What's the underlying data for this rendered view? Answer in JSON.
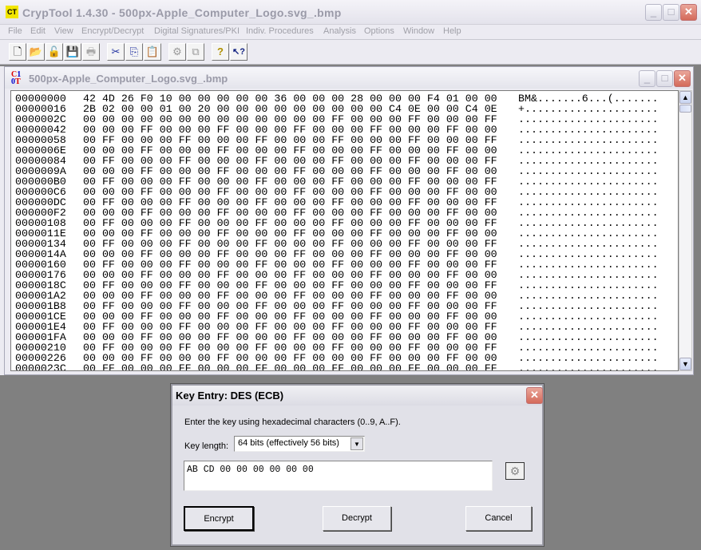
{
  "app": {
    "title": "CrypTool 1.4.30 - 500px-Apple_Computer_Logo.svg_.bmp",
    "icon": "cryptool-app-icon"
  },
  "window_controls": {
    "minimize": "_",
    "maximize": "□",
    "close": "✕"
  },
  "menu": [
    "File",
    "Edit",
    "View",
    "Encrypt/Decrypt",
    "Digital Signatures/PKI",
    "Indiv. Procedures",
    "Analysis",
    "Options",
    "Window",
    "Help"
  ],
  "toolbar": [
    {
      "name": "new-document-icon",
      "glyph": "🗋"
    },
    {
      "name": "open-folder-icon",
      "glyph": "📂"
    },
    {
      "name": "open-unlock-icon",
      "glyph": "🔓"
    },
    {
      "name": "save-disk-icon",
      "glyph": "💾"
    },
    {
      "name": "print-icon",
      "glyph": "🖶"
    },
    {
      "name": "cut-scissors-icon",
      "glyph": "✂"
    },
    {
      "name": "copy-icon",
      "glyph": "⎘"
    },
    {
      "name": "paste-icon",
      "glyph": "📋"
    },
    {
      "name": "key-icon",
      "glyph": "⚙"
    },
    {
      "name": "window-tile-icon",
      "glyph": "⧉"
    },
    {
      "name": "help-icon",
      "glyph": "?"
    },
    {
      "name": "context-help-icon",
      "glyph": "↖?"
    }
  ],
  "document": {
    "title": "500px-Apple_Computer_Logo.svg_.bmp",
    "icon": "ct-document-icon",
    "rows": [
      {
        "addr": "00000000",
        "hex": "42 4D 26 F0 10 00 00 00 00 00 36 00 00 00 28 00 00 00 F4 01 00 00",
        "ascii": "BM&.......6...(......."
      },
      {
        "addr": "00000016",
        "hex": "2B 02 00 00 01 00 20 00 00 00 00 00 00 00 00 00 C4 0E 00 00 C4 0E",
        "ascii": "+....................."
      },
      {
        "addr": "0000002C",
        "hex": "00 00 00 00 00 00 00 00 00 00 00 00 00 FF 00 00 00 FF 00 00 00 FF",
        "ascii": "......................"
      },
      {
        "addr": "00000042",
        "hex": "00 00 00 FF 00 00 00 FF 00 00 00 FF 00 00 00 FF 00 00 00 FF 00 00",
        "ascii": "......................"
      },
      {
        "addr": "00000058",
        "hex": "00 FF 00 00 00 FF 00 00 00 FF 00 00 00 FF 00 00 00 FF 00 00 00 FF",
        "ascii": "......................"
      },
      {
        "addr": "0000006E",
        "hex": "00 00 00 FF 00 00 00 FF 00 00 00 FF 00 00 00 FF 00 00 00 FF 00 00",
        "ascii": "......................"
      },
      {
        "addr": "00000084",
        "hex": "00 FF 00 00 00 FF 00 00 00 FF 00 00 00 FF 00 00 00 FF 00 00 00 FF",
        "ascii": "......................"
      },
      {
        "addr": "0000009A",
        "hex": "00 00 00 FF 00 00 00 FF 00 00 00 FF 00 00 00 FF 00 00 00 FF 00 00",
        "ascii": "......................"
      },
      {
        "addr": "000000B0",
        "hex": "00 FF 00 00 00 FF 00 00 00 FF 00 00 00 FF 00 00 00 FF 00 00 00 FF",
        "ascii": "......................"
      },
      {
        "addr": "000000C6",
        "hex": "00 00 00 FF 00 00 00 FF 00 00 00 FF 00 00 00 FF 00 00 00 FF 00 00",
        "ascii": "......................"
      },
      {
        "addr": "000000DC",
        "hex": "00 FF 00 00 00 FF 00 00 00 FF 00 00 00 FF 00 00 00 FF 00 00 00 FF",
        "ascii": "......................"
      },
      {
        "addr": "000000F2",
        "hex": "00 00 00 FF 00 00 00 FF 00 00 00 FF 00 00 00 FF 00 00 00 FF 00 00",
        "ascii": "......................"
      },
      {
        "addr": "00000108",
        "hex": "00 FF 00 00 00 FF 00 00 00 FF 00 00 00 FF 00 00 00 FF 00 00 00 FF",
        "ascii": "......................"
      },
      {
        "addr": "0000011E",
        "hex": "00 00 00 FF 00 00 00 FF 00 00 00 FF 00 00 00 FF 00 00 00 FF 00 00",
        "ascii": "......................"
      },
      {
        "addr": "00000134",
        "hex": "00 FF 00 00 00 FF 00 00 00 FF 00 00 00 FF 00 00 00 FF 00 00 00 FF",
        "ascii": "......................"
      },
      {
        "addr": "0000014A",
        "hex": "00 00 00 FF 00 00 00 FF 00 00 00 FF 00 00 00 FF 00 00 00 FF 00 00",
        "ascii": "......................"
      },
      {
        "addr": "00000160",
        "hex": "00 FF 00 00 00 FF 00 00 00 FF 00 00 00 FF 00 00 00 FF 00 00 00 FF",
        "ascii": "......................"
      },
      {
        "addr": "00000176",
        "hex": "00 00 00 FF 00 00 00 FF 00 00 00 FF 00 00 00 FF 00 00 00 FF 00 00",
        "ascii": "......................"
      },
      {
        "addr": "0000018C",
        "hex": "00 FF 00 00 00 FF 00 00 00 FF 00 00 00 FF 00 00 00 FF 00 00 00 FF",
        "ascii": "......................"
      },
      {
        "addr": "000001A2",
        "hex": "00 00 00 FF 00 00 00 FF 00 00 00 FF 00 00 00 FF 00 00 00 FF 00 00",
        "ascii": "......................"
      },
      {
        "addr": "000001B8",
        "hex": "00 FF 00 00 00 FF 00 00 00 FF 00 00 00 FF 00 00 00 FF 00 00 00 FF",
        "ascii": "......................"
      },
      {
        "addr": "000001CE",
        "hex": "00 00 00 FF 00 00 00 FF 00 00 00 FF 00 00 00 FF 00 00 00 FF 00 00",
        "ascii": "......................"
      },
      {
        "addr": "000001E4",
        "hex": "00 FF 00 00 00 FF 00 00 00 FF 00 00 00 FF 00 00 00 FF 00 00 00 FF",
        "ascii": "......................"
      },
      {
        "addr": "000001FA",
        "hex": "00 00 00 FF 00 00 00 FF 00 00 00 FF 00 00 00 FF 00 00 00 FF 00 00",
        "ascii": "......................"
      },
      {
        "addr": "00000210",
        "hex": "00 FF 00 00 00 FF 00 00 00 FF 00 00 00 FF 00 00 00 FF 00 00 00 FF",
        "ascii": "......................"
      },
      {
        "addr": "00000226",
        "hex": "00 00 00 FF 00 00 00 FF 00 00 00 FF 00 00 00 FF 00 00 00 FF 00 00",
        "ascii": "......................"
      },
      {
        "addr": "0000023C",
        "hex": "00 FF 00 00 00 FF 00 00 00 FF 00 00 00 FF 00 00 00 FF 00 00 00 FF",
        "ascii": "......................"
      }
    ]
  },
  "dialog": {
    "title": "Key Entry: DES (ECB)",
    "instruction": "Enter the key using hexadecimal characters (0..9, A..F).",
    "key_length_label": "Key length:",
    "key_length_value": "64 bits (effectively 56 bits)",
    "key_value": "AB CD 00 00 00 00 00 00",
    "encrypt_label": "Encrypt",
    "decrypt_label": "Decrypt",
    "cancel_label": "Cancel"
  }
}
